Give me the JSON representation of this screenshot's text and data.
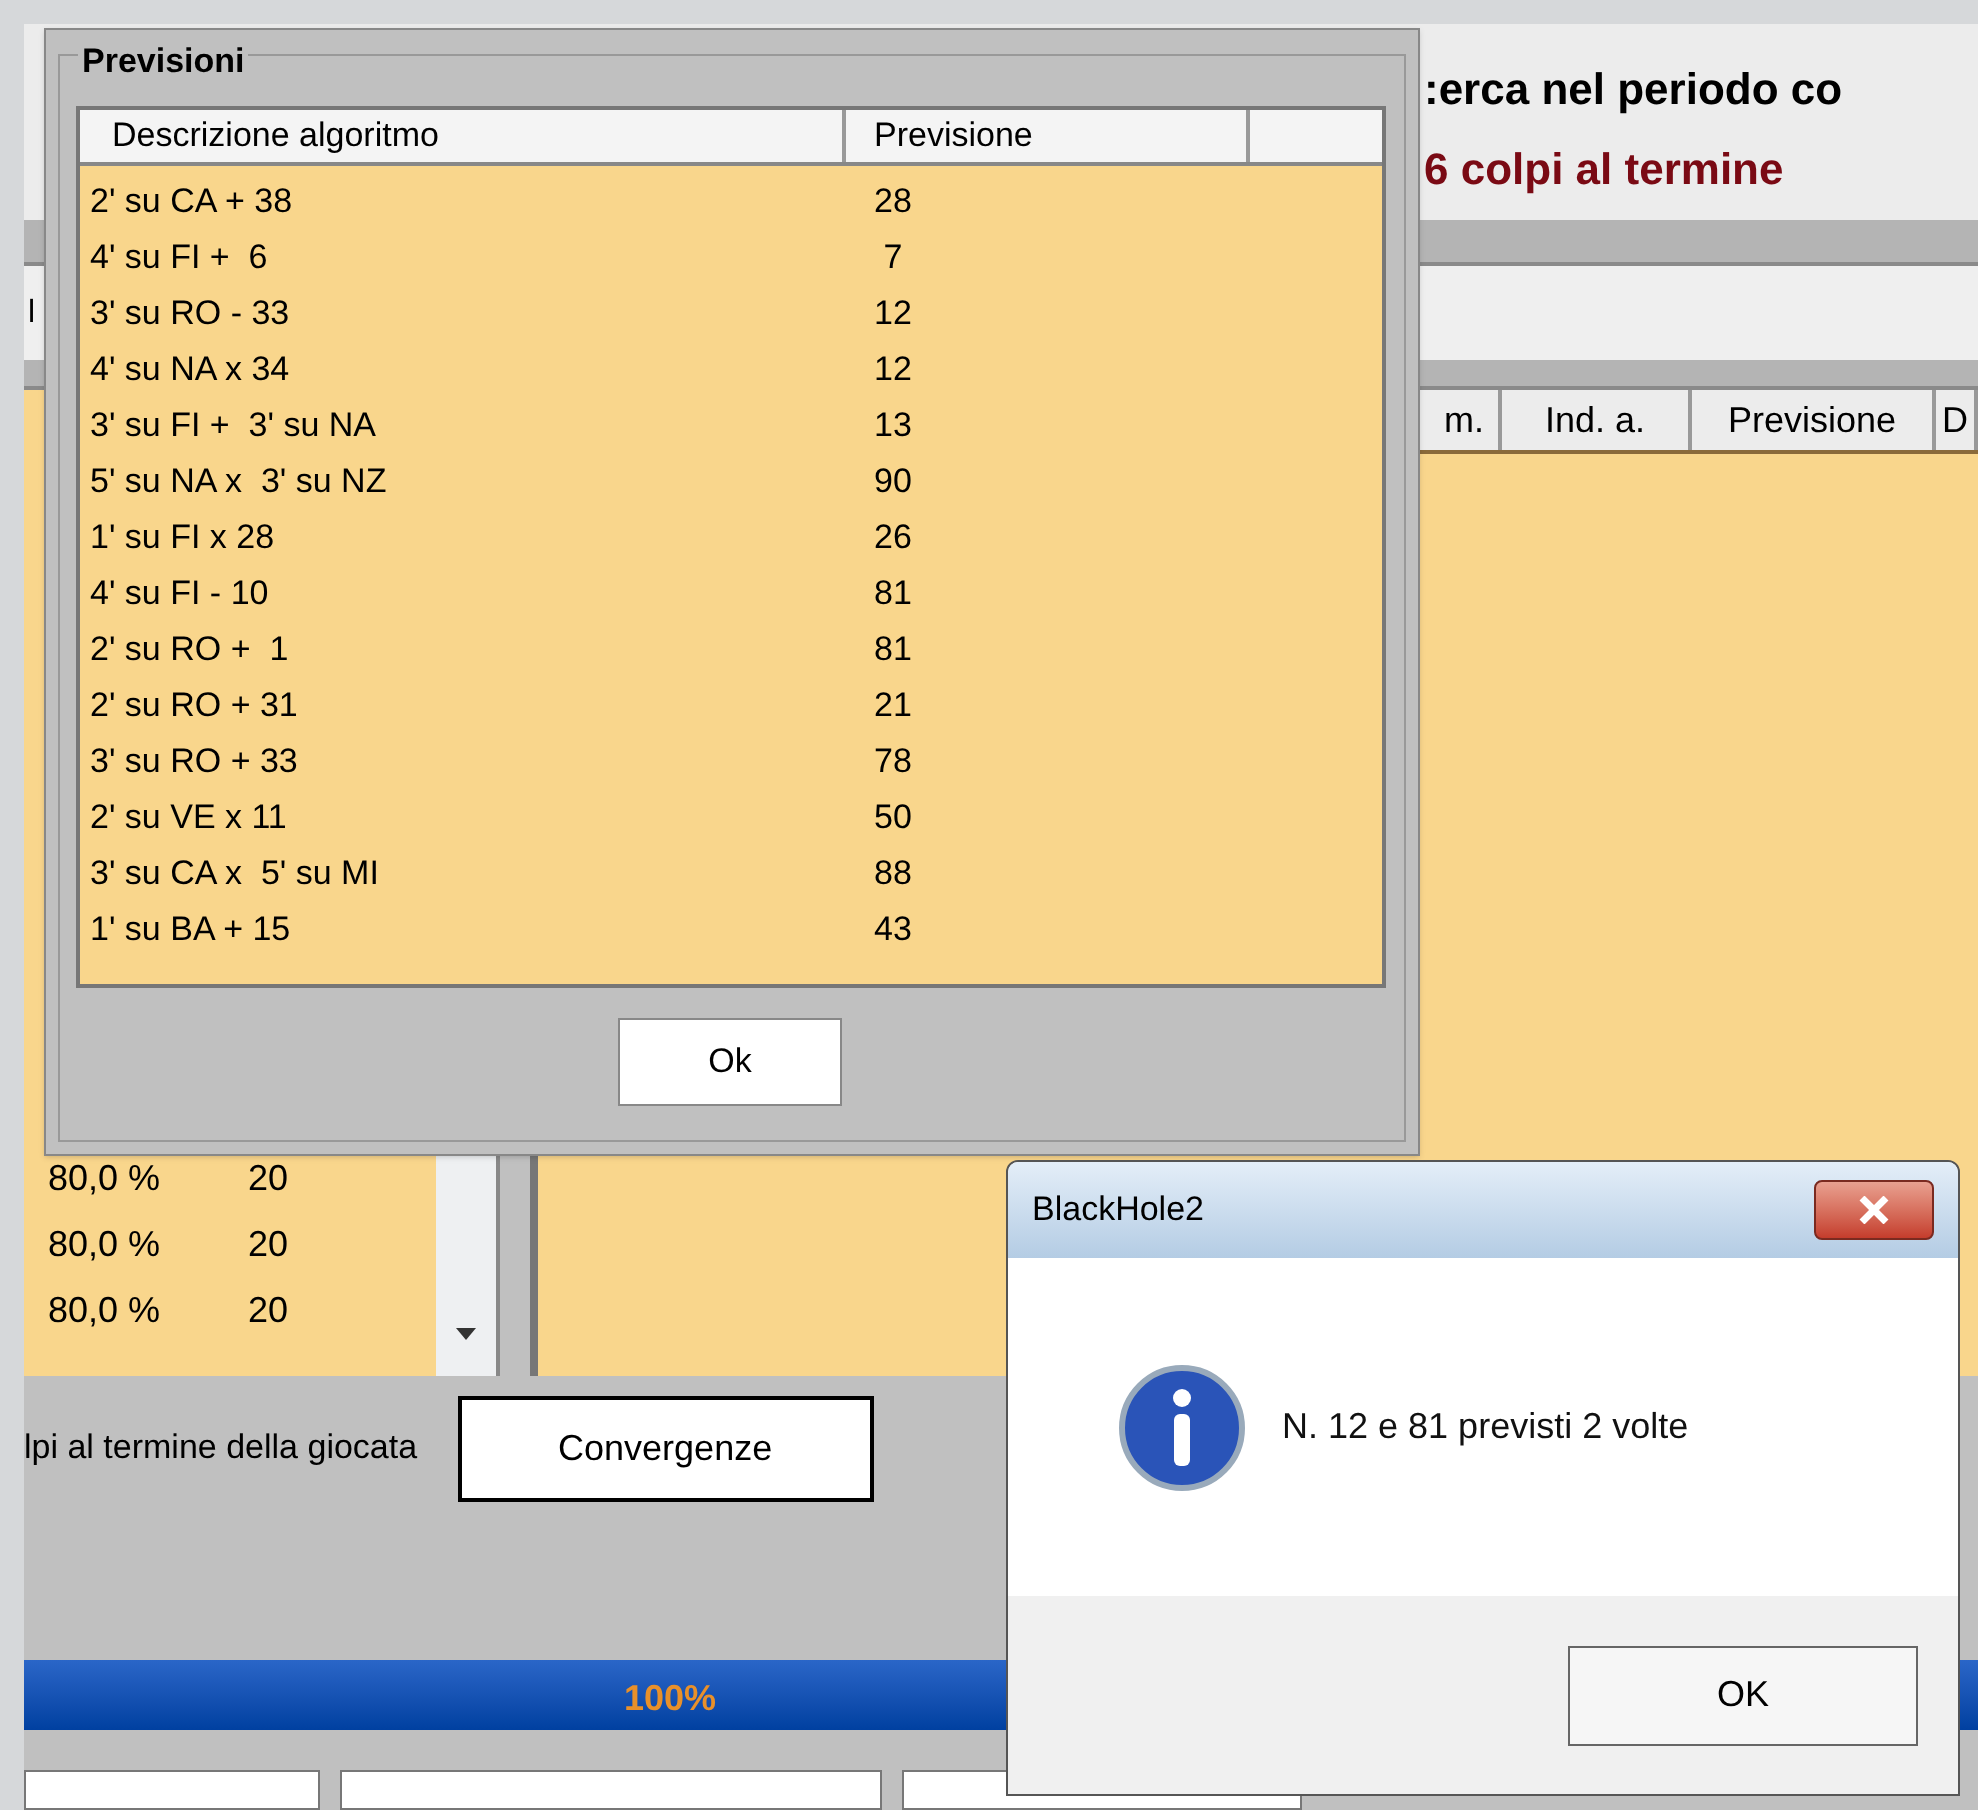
{
  "main_window": {
    "heading": ":erca nel periodo co",
    "subheading": "6 colpi al termine",
    "cut_label": "l",
    "table": {
      "columns": [
        "m.",
        "Ind. a.",
        "Previsione",
        "D"
      ]
    },
    "left_table": {
      "rows": [
        {
          "column_1": "80,0 %",
          "column_2": "20"
        },
        {
          "column_1": "80,0 %",
          "column_2": "20"
        },
        {
          "column_1": "80,0 %",
          "column_2": "20"
        }
      ]
    },
    "note": "lpi al termine della giocata",
    "convergenze_button": "Convergenze",
    "progress": {
      "level": 1,
      "label": "100%"
    }
  },
  "previsioni_dialog": {
    "title": "Previsioni",
    "columns": [
      "Descrizione algoritmo",
      "Previsione"
    ],
    "rows": [
      {
        "description": "2' su CA + 38",
        "forecast": "28"
      },
      {
        "description": "4' su FI +  6",
        "forecast": " 7"
      },
      {
        "description": "3' su RO - 33",
        "forecast": "12"
      },
      {
        "description": "4' su NA x 34",
        "forecast": "12"
      },
      {
        "description": "3' su FI +  3' su NA",
        "forecast": "13"
      },
      {
        "description": "5' su NA x  3' su NZ",
        "forecast": "90"
      },
      {
        "description": "1' su FI x 28",
        "forecast": "26"
      },
      {
        "description": "4' su FI - 10",
        "forecast": "81"
      },
      {
        "description": "2' su RO +  1",
        "forecast": "81"
      },
      {
        "description": "2' su RO + 31",
        "forecast": "21"
      },
      {
        "description": "3' su RO + 33",
        "forecast": "78"
      },
      {
        "description": "2' su VE x 11",
        "forecast": "50"
      },
      {
        "description": "3' su CA x  5' su MI",
        "forecast": "88"
      },
      {
        "description": "1' su BA + 15",
        "forecast": "43"
      }
    ],
    "ok_button": "Ok"
  },
  "message_box": {
    "title": "BlackHole2",
    "message": "N. 12 e 81 previsti 2 volte",
    "button": "OK"
  }
}
